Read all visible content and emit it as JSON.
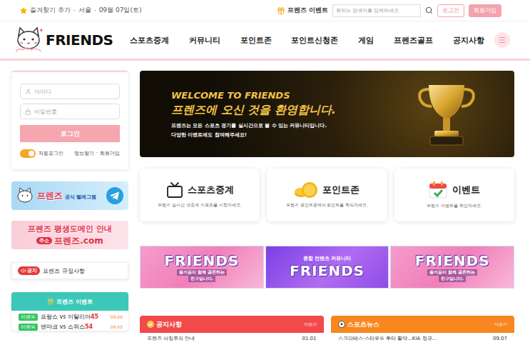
{
  "topbar": {
    "favorite": "즐겨찾기 추가",
    "separator": "·",
    "city": "서울",
    "date": "09월 07일(토)",
    "event_link": "프렌즈 이벤트",
    "search": {
      "placeholder": "원하는 검색어를 입력하세요."
    },
    "buttons": [
      {
        "label": "로그인",
        "kind": "outline"
      },
      {
        "label": "회원가입",
        "kind": "filled"
      }
    ]
  },
  "logo": {
    "text": "FRIENDS"
  },
  "nav": {
    "items": [
      {
        "label": "스포츠중계",
        "selected": false
      },
      {
        "label": "커뮤니티",
        "selected": false
      },
      {
        "label": "포인트존",
        "selected": false
      },
      {
        "label": "포인트신청존",
        "selected": false
      },
      {
        "label": "게임",
        "selected": false
      },
      {
        "label": "프렌즈골프",
        "selected": false
      },
      {
        "label": "공지사항",
        "selected": false
      }
    ]
  },
  "login_box": {
    "id_placeholder": "아이디",
    "password_placeholder": "비밀번호",
    "button": "로그인",
    "auto_login": {
      "label": "자동로그인",
      "on": true
    },
    "links": [
      "정보찾기",
      "회원가입"
    ],
    "separator": "·"
  },
  "side_banners": [
    {
      "kind": "telegram",
      "title": "프렌즈",
      "subtitle": "공식 텔레그램"
    },
    {
      "kind": "domain",
      "title": "프렌즈 평생도메인 안내",
      "badge": "주소",
      "domain": "프렌즈.com"
    }
  ],
  "notice": {
    "badge": "공지",
    "text": "프렌즈 규정사항"
  },
  "events": {
    "title": "프렌즈 이벤트",
    "rows": [
      {
        "badge": "이벤트",
        "title": "프랑스 vs 이탈리아",
        "count": "45",
        "date": "09.06"
      },
      {
        "badge": "이벤트",
        "title": "덴마크 vs 스위스",
        "count": "54",
        "date": "09.05"
      }
    ]
  },
  "hero": {
    "eyebrow": "WELCOME TO FRIENDS",
    "title": "프렌즈에 오신 것을 환영합니다.",
    "lines": [
      "프렌즈는 모든 스포츠 경기를 실시간으로 볼 수 있는 커뮤니티입니다.",
      "다양한 이벤트에도 참여해주세요!"
    ]
  },
  "features": [
    {
      "kind": "tv",
      "title": "스포츠중계",
      "desc": "프렌즈 실시간 생중계 스포츠를 시청하세요."
    },
    {
      "kind": "coin",
      "title": "포인트존",
      "desc": "프렌즈 포인트존에서 포인트를 획득하세요."
    },
    {
      "kind": "calendar",
      "title": "이벤트",
      "desc": "프렌즈 이벤트를 확인하세요."
    }
  ],
  "promo_banners": [
    {
      "kind": "pink",
      "title": "FRIENDS",
      "caption": [
        "즐거움이 함께 공존하는",
        "친구입니다."
      ]
    },
    {
      "kind": "purple",
      "tag": "종합 컨텐츠 커뮤니티",
      "title": "FRIENDS"
    },
    {
      "kind": "pink",
      "title": "FRIENDS",
      "caption": [
        "즐거움이 함께 공존하는",
        "친구입니다."
      ]
    }
  ],
  "boards": [
    {
      "title": "공지사항",
      "more": "더보기",
      "color": "#f24a4a",
      "rows": [
        {
          "title": "프렌즈 사칭주의 안내",
          "date": "01.01"
        }
      ]
    },
    {
      "title": "스포츠뉴스",
      "more": "더보기",
      "color": "#f7871e",
      "rows": [
        {
          "title": "스크라테스·스타우트 투타 활약...KIA 정규...",
          "date": "09.07"
        }
      ]
    }
  ]
}
